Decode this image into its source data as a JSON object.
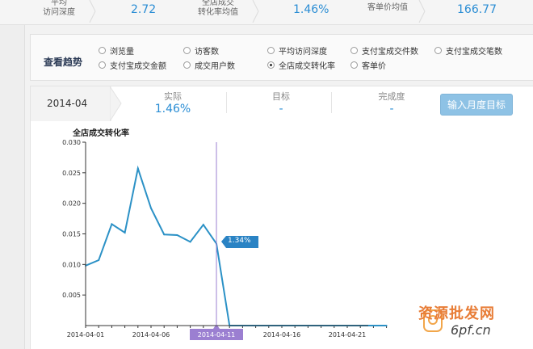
{
  "metrics": [
    {
      "label": "平均\n访问深度",
      "value": "2.72"
    },
    {
      "label": "全店成交\n转化率均值",
      "value": "1.46%"
    },
    {
      "label": "客单价均值",
      "value": "166.77"
    }
  ],
  "trend": {
    "title": "查看趋势",
    "options": [
      {
        "label": "浏览量",
        "selected": false
      },
      {
        "label": "访客数",
        "selected": false
      },
      {
        "label": "平均访问深度",
        "selected": false
      },
      {
        "label": "支付宝成交件数",
        "selected": false
      },
      {
        "label": "支付宝成交笔数",
        "selected": false
      },
      {
        "label": "支付宝成交金额",
        "selected": false
      },
      {
        "label": "成交用户数",
        "selected": false
      },
      {
        "label": "全店成交转化率",
        "selected": true
      },
      {
        "label": "客单价",
        "selected": false
      }
    ]
  },
  "target": {
    "month": "2014-04",
    "actual_label": "实际",
    "actual_value": "1.46%",
    "goal_label": "目标",
    "goal_value": "-",
    "completion_label": "完成度",
    "completion_value": "-",
    "button_label": "输入月度目标"
  },
  "watermark": {
    "cn": "资源批发网",
    "url": "6pf.cn"
  },
  "chart_data": {
    "type": "line",
    "title": "全店成交转化率",
    "series": [
      {
        "x": [
          "2014-04-01",
          "2014-04-02",
          "2014-04-03",
          "2014-04-04",
          "2014-04-05",
          "2014-04-06",
          "2014-04-07",
          "2014-04-08",
          "2014-04-09",
          "2014-04-10",
          "2014-04-11",
          "2014-04-12",
          "2014-04-13",
          "2014-04-14",
          "2014-04-15",
          "2014-04-16",
          "2014-04-17",
          "2014-04-18",
          "2014-04-19",
          "2014-04-20",
          "2014-04-21",
          "2014-04-22",
          "2014-04-23",
          "2014-04-24"
        ],
        "values": [
          0.0098,
          0.0107,
          0.0166,
          0.0152,
          0.0257,
          0.0192,
          0.0149,
          0.0148,
          0.0137,
          0.0165,
          0.0134,
          0,
          0,
          0,
          0,
          0,
          0,
          0,
          0,
          0,
          0,
          0,
          0,
          0
        ]
      }
    ],
    "xticks": [
      "2014-04-01",
      "2014-04-06",
      "2014-04-11",
      "2014-04-16",
      "2014-04-21"
    ],
    "yticks": [
      "0.030",
      "0.025",
      "0.020",
      "0.015",
      "0.010",
      "0.005"
    ],
    "ylim": [
      0,
      0.03
    ],
    "highlight_index": 10,
    "highlight_label": "1.34%",
    "colors": {
      "line": "#2b91c6",
      "highlight": "#9b7fd1",
      "tooltip": "#2a83c4"
    }
  }
}
